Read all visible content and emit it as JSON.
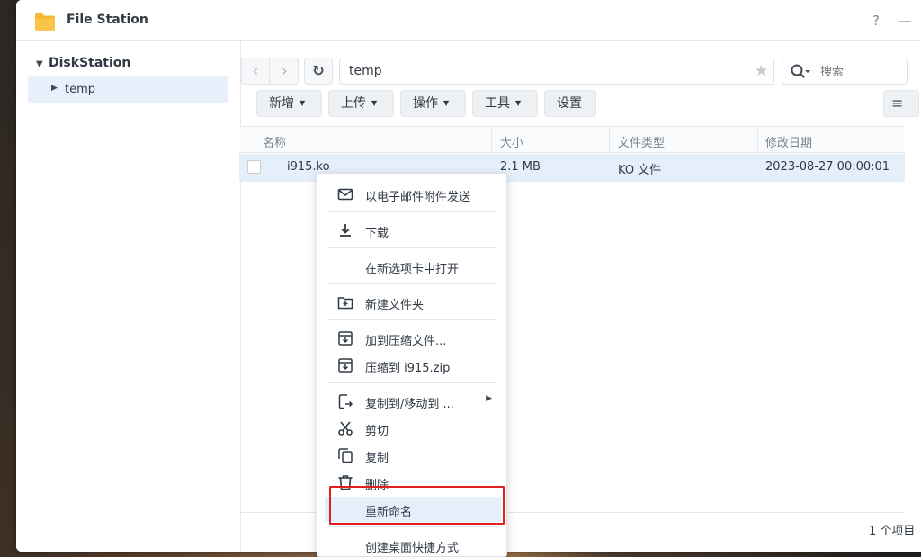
{
  "window": {
    "title": "File Station",
    "help_label": "?",
    "minimize_label": "—"
  },
  "sidebar": {
    "root_label": "DiskStation",
    "items": [
      {
        "label": "temp"
      }
    ]
  },
  "toolbar": {
    "back_label": "‹",
    "forward_label": "›",
    "refresh_label": "↻",
    "path": "temp",
    "search_placeholder": "搜索",
    "buttons": {
      "new": "新增",
      "upload": "上传",
      "action": "操作",
      "tools": "工具",
      "settings": "设置"
    }
  },
  "table": {
    "columns": [
      "名称",
      "大小",
      "文件类型",
      "修改日期"
    ],
    "rows": [
      {
        "name": "i915.ko",
        "size": "2.1 MB",
        "type": "KO 文件",
        "modified": "2023-08-27 00:00:01"
      }
    ]
  },
  "status": {
    "count_text": "1 个项目"
  },
  "context_menu": {
    "items": [
      {
        "label": "以电子邮件附件发送",
        "icon": "envelope-icon"
      },
      {
        "label": "下载",
        "icon": "download-icon"
      },
      {
        "label": "在新选项卡中打开",
        "icon": ""
      },
      {
        "label": "新建文件夹",
        "icon": "new-folder-icon"
      },
      {
        "label": "加到压缩文件...",
        "icon": "archive-add-icon"
      },
      {
        "label": "压缩到 i915.zip",
        "icon": "archive-icon"
      },
      {
        "label": "复制到/移动到 ...",
        "icon": "copy-move-icon"
      },
      {
        "label": "剪切",
        "icon": "scissors-icon"
      },
      {
        "label": "复制",
        "icon": "copy-icon"
      },
      {
        "label": "删除",
        "icon": "trash-icon"
      },
      {
        "label": "重新命名",
        "icon": ""
      },
      {
        "label": "创建桌面快捷方式",
        "icon": ""
      }
    ]
  },
  "colors": {
    "selection": "#e5effa",
    "highlight_outline": "#e02020",
    "folder": "#f5b82e"
  }
}
